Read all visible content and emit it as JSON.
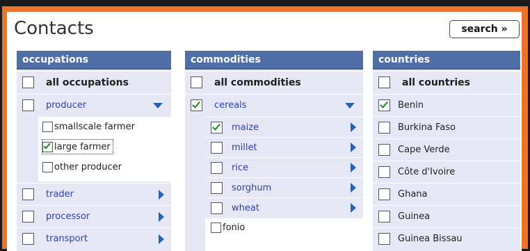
{
  "page": {
    "title": "Contacts",
    "search_label": "search »"
  },
  "colors": {
    "frame_accent": "#e8742e",
    "header_bg": "#4f6fa6",
    "panel_bg": "#e6e9f5",
    "link_text": "#2f3fa8",
    "arrow": "#2b5fb0",
    "check": "#178a17"
  },
  "occupations": {
    "header": "occupations",
    "all_label": "all occupations",
    "all_checked": false,
    "items": [
      {
        "label": "producer",
        "checked": false,
        "expanded": true
      },
      {
        "label": "trader",
        "checked": false
      },
      {
        "label": "processor",
        "checked": false
      },
      {
        "label": "transport",
        "checked": false
      }
    ],
    "sub_items": [
      {
        "label": "smallscale farmer",
        "checked": false
      },
      {
        "label": "large farmer",
        "checked": true
      },
      {
        "label": "other producer",
        "checked": false
      }
    ]
  },
  "commodities": {
    "header": "commodities",
    "all_label": "all commodities",
    "all_checked": false,
    "items": [
      {
        "label": "cereals",
        "checked": true,
        "expanded": true
      }
    ],
    "sub_items": [
      {
        "label": "maize",
        "checked": true
      },
      {
        "label": "millet",
        "checked": false
      },
      {
        "label": "rice",
        "checked": false
      },
      {
        "label": "sorghum",
        "checked": false
      },
      {
        "label": "wheat",
        "checked": false
      },
      {
        "label": "fonio",
        "checked": false
      }
    ]
  },
  "countries": {
    "header": "countries",
    "all_label": "all countries",
    "all_checked": false,
    "items": [
      {
        "label": "Benin",
        "checked": true
      },
      {
        "label": "Burkina Faso",
        "checked": false
      },
      {
        "label": "Cape Verde",
        "checked": false
      },
      {
        "label": "Côte d'Ivoire",
        "checked": false
      },
      {
        "label": "Ghana",
        "checked": false
      },
      {
        "label": "Guinea",
        "checked": false
      },
      {
        "label": "Guinea Bissau",
        "checked": false
      }
    ]
  }
}
